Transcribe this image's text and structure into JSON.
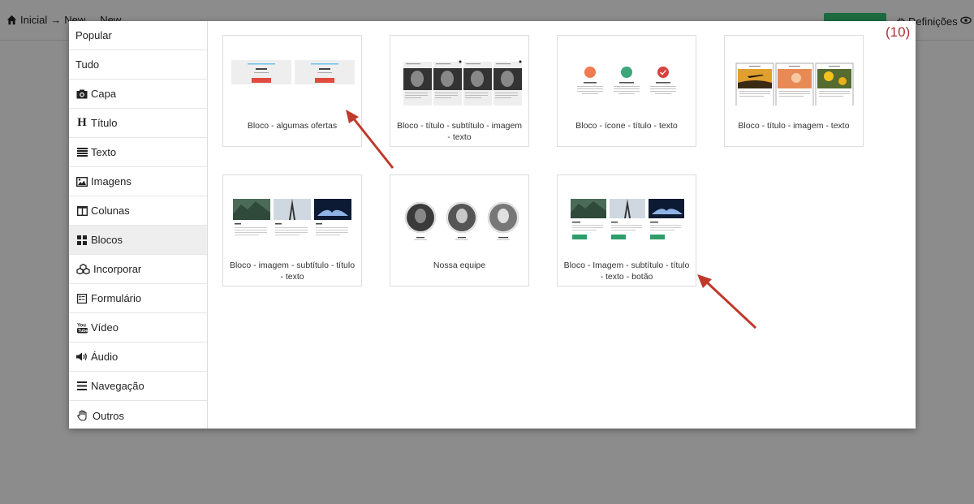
{
  "topbar": {
    "home": "Inicial",
    "arrow": "→",
    "crumb_new": "New",
    "crumb_new2": "New",
    "settings": "Definições"
  },
  "counter": "(10)",
  "sidebar": {
    "items": [
      {
        "label": "Popular",
        "icon": ""
      },
      {
        "label": "Tudo",
        "icon": ""
      },
      {
        "label": "Capa",
        "icon": "camera-icon"
      },
      {
        "label": "Título",
        "icon": "heading-icon"
      },
      {
        "label": "Texto",
        "icon": "text-lines-icon"
      },
      {
        "label": "Imagens",
        "icon": "image-icon"
      },
      {
        "label": "Colunas",
        "icon": "columns-icon"
      },
      {
        "label": "Blocos",
        "icon": "blocks-icon"
      },
      {
        "label": "Incorporar",
        "icon": "embed-icon"
      },
      {
        "label": "Formulário",
        "icon": "form-icon"
      },
      {
        "label": "Vídeo",
        "icon": "youtube-icon"
      },
      {
        "label": "Áudio",
        "icon": "volume-icon"
      },
      {
        "label": "Navegação",
        "icon": "menu-icon"
      },
      {
        "label": "Outros",
        "icon": "hand-icon"
      }
    ],
    "active_index": 7
  },
  "cards": [
    {
      "label": "Bloco - algumas ofertas"
    },
    {
      "label": "Bloco - título - subtítulo - imagem - texto"
    },
    {
      "label": "Bloco - ícone - título - texto"
    },
    {
      "label": "Bloco - título - imagem - texto"
    },
    {
      "label": "Bloco - imagem - subtítulo - título - texto"
    },
    {
      "label": "Nossa equipe"
    },
    {
      "label": "Bloco - Imagem - subtítulo - título - texto - botão"
    }
  ],
  "colors": {
    "accent_green": "#1d6b3f",
    "arrow_red": "#c0392b",
    "counter": "#a33333"
  }
}
